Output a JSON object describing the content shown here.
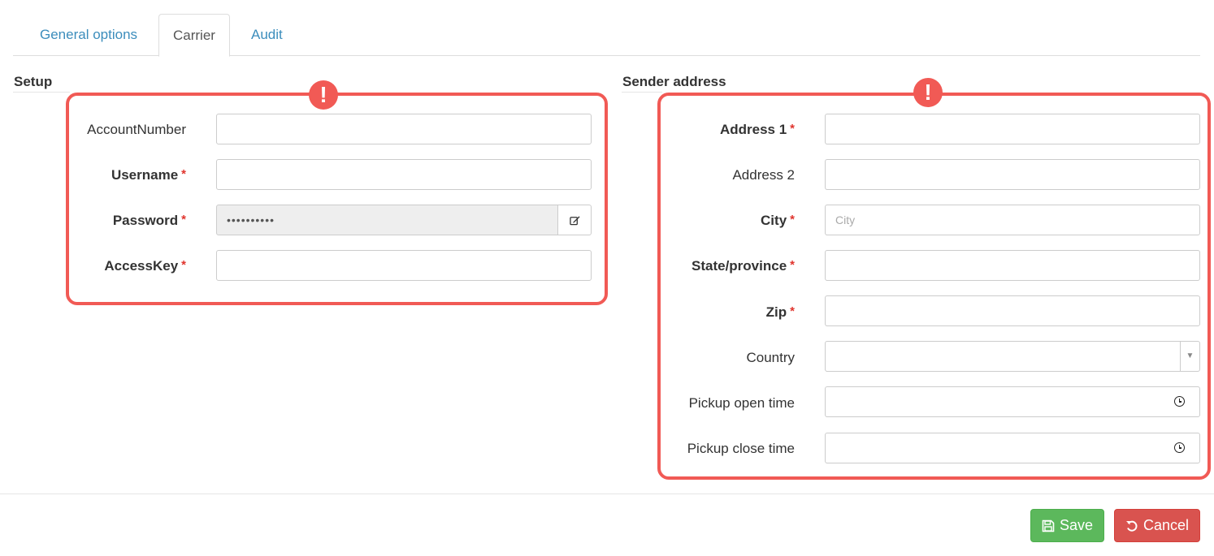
{
  "tabs": [
    {
      "label": "General options",
      "active": false
    },
    {
      "label": "Carrier",
      "active": true
    },
    {
      "label": "Audit",
      "active": false
    }
  ],
  "setup": {
    "title": "Setup",
    "fields": {
      "account_number": {
        "label": "AccountNumber",
        "value": "",
        "required": false
      },
      "username": {
        "label": "Username",
        "value": "",
        "required": true
      },
      "password": {
        "label": "Password",
        "value": "••••••••••",
        "required": true
      },
      "access_key": {
        "label": "AccessKey",
        "value": "",
        "required": true
      }
    }
  },
  "sender": {
    "title": "Sender address",
    "fields": {
      "address1": {
        "label": "Address 1",
        "value": "",
        "required": true
      },
      "address2": {
        "label": "Address 2",
        "value": "",
        "required": false
      },
      "city": {
        "label": "City",
        "placeholder": "City",
        "required": true
      },
      "state": {
        "label": "State/province",
        "value": "",
        "required": true
      },
      "zip": {
        "label": "Zip",
        "value": "",
        "required": true
      },
      "country": {
        "label": "Country",
        "value": "",
        "required": false
      },
      "pickup_open": {
        "label": "Pickup open time",
        "value": "",
        "required": false
      },
      "pickup_close": {
        "label": "Pickup close time",
        "value": "",
        "required": false
      }
    }
  },
  "alerts": {
    "badge_symbol": "!"
  },
  "required_marker": "*",
  "buttons": {
    "save": "Save",
    "cancel": "Cancel"
  },
  "colors": {
    "link": "#3c8dbc",
    "required": "#e0342d",
    "highlight": "#f15a55",
    "save": "#5cb85c",
    "cancel": "#d9534f"
  }
}
